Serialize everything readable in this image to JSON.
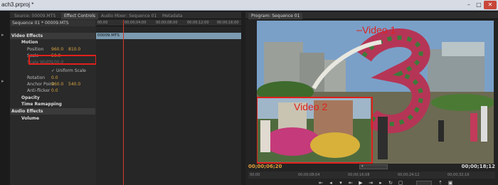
{
  "window": {
    "title": "ach3.prproj *"
  },
  "tabs": {
    "left": [
      "Source: 00009.MTS",
      "Effect Controls",
      "Audio Mixer: Sequence 01",
      "Metadata"
    ],
    "right": [
      "Program: Sequence 01"
    ]
  },
  "effect_controls": {
    "clip_path": "Sequence 01 * 00009.MTS",
    "clip_name": "00009.MTS",
    "ruler": [
      "00;00",
      "00;00;04;00",
      "00;00;08;00",
      "00;00;12;00",
      "00;00;16;00"
    ],
    "video_effects": "Video Effects",
    "motion": "Motion",
    "position_label": "Position",
    "position_x": "960.0",
    "position_y": "810.0",
    "scale_label": "Scale",
    "scale_value": "50.0",
    "scale_width_label": "Scale Width",
    "scale_width_value": "100.0",
    "uniform_label": "Uniform Scale",
    "rotation_label": "Rotation",
    "rotation_value": "0.0",
    "anchor_label": "Anchor Point",
    "anchor_x": "960.0",
    "anchor_y": "540.0",
    "antiflicker_label": "Anti-flicker",
    "antiflicker_value": "0.0",
    "opacity": "Opacity",
    "time_remapping": "Time Remapping",
    "audio_effects": "Audio Effects",
    "volume": "Volume"
  },
  "program": {
    "overlay_label_1": "Video 1",
    "overlay_label_2": "Video 2",
    "tc_current": "00;00;06;20",
    "tc_duration": "00;00;18;12",
    "ruler": [
      "00;00",
      "00;00;08;04",
      "00;00;16;08",
      "00;00;24;12",
      "00;00;32;16"
    ]
  },
  "colors": {
    "highlight": "#e0201c",
    "timecode": "#e3a03a",
    "playhead": "#d23a2e"
  }
}
